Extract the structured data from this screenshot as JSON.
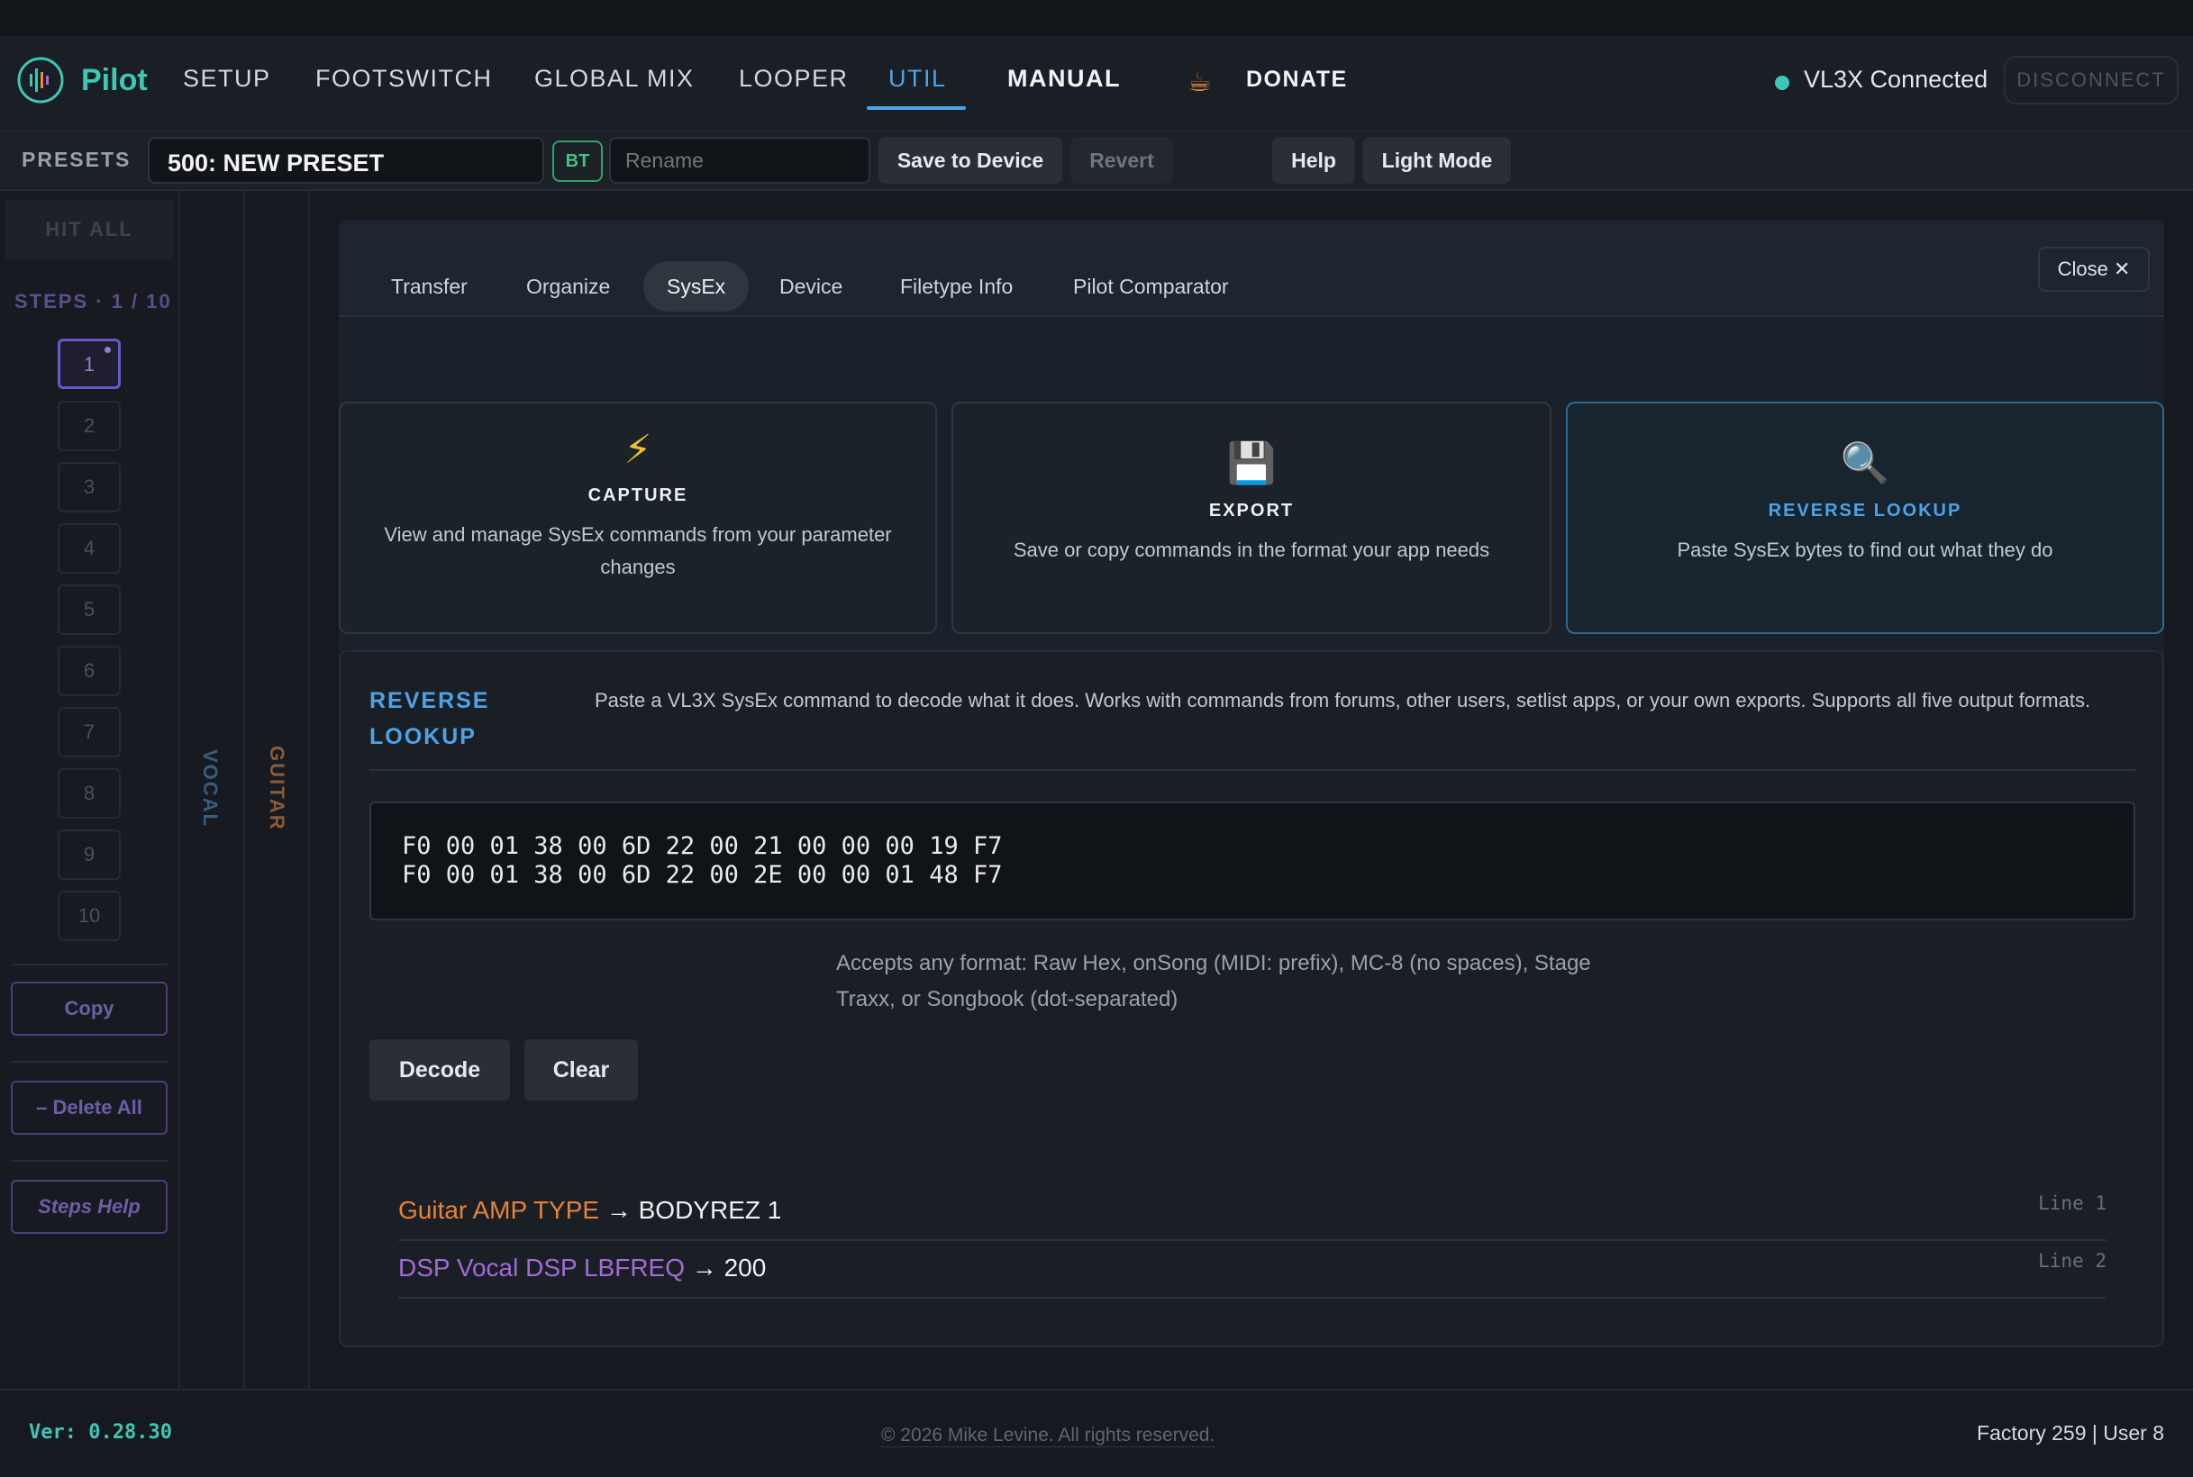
{
  "nav": {
    "brand": "Pilot",
    "items": [
      "SETUP",
      "FOOTSWITCH",
      "GLOBAL MIX",
      "LOOPER",
      "UTIL",
      "MANUAL",
      "DONATE"
    ],
    "active": "UTIL",
    "status": "VL3X Connected",
    "disconnect": "DISCONNECT",
    "accent_color": "#4da3e8",
    "brand_color": "#3dc7b5"
  },
  "presets": {
    "label": "PRESETS",
    "current": "500: NEW PRESET",
    "bt_badge": "BT",
    "rename_placeholder": "Rename",
    "save": "Save to Device",
    "revert": "Revert",
    "help": "Help",
    "light_mode": "Light Mode"
  },
  "sidebar": {
    "hit_all": "HIT ALL",
    "steps_label": "STEPS · 1 / 10",
    "steps": [
      "1",
      "2",
      "3",
      "4",
      "5",
      "6",
      "7",
      "8",
      "9",
      "10"
    ],
    "copy": "Copy",
    "delete_all": "– Delete All",
    "steps_help": "Steps Help",
    "vocal": "VOCAL",
    "guitar": "GUITAR"
  },
  "util": {
    "tabs": [
      "Transfer",
      "Organize",
      "SysEx",
      "Device",
      "Filetype Info",
      "Pilot Comparator"
    ],
    "active_tab": "SysEx",
    "close": "Close ✕",
    "cards": [
      {
        "icon": "lightning-icon",
        "glyph": "⚡",
        "title": "CAPTURE",
        "desc": "View and manage SysEx commands from your parameter changes"
      },
      {
        "icon": "floppy-disk-icon",
        "glyph": "💾",
        "title": "EXPORT",
        "desc": "Save or copy commands in the format your app needs"
      },
      {
        "icon": "magnifier-icon",
        "glyph": "🔍",
        "title": "REVERSE LOOKUP",
        "desc": "Paste SysEx bytes to find out what they do"
      }
    ],
    "lookup": {
      "title": "REVERSE LOOKUP",
      "description": "Paste a VL3X SysEx command to decode what it does. Works with commands from forums, other users, setlist apps, or your own exports. Supports all five output formats.",
      "input_value": "F0 00 01 38 00 6D 22 00 21 00 00 00 19 F7\nF0 00 01 38 00 6D 22 00 2E 00 00 01 48 F7",
      "accepts": "Accepts any format: Raw Hex, onSong (MIDI: prefix), MC-8 (no spaces), Stage Traxx, or Songbook (dot-separated)",
      "decode": "Decode",
      "clear": "Clear",
      "results": [
        {
          "param": "Guitar AMP TYPE",
          "arrow": "→",
          "value": "BODYREZ 1",
          "line": "Line 1",
          "color": "#e6823a"
        },
        {
          "param": "DSP Vocal DSP LBFREQ",
          "arrow": "→",
          "value": "200",
          "line": "Line 2",
          "color": "#a36ad6"
        }
      ]
    }
  },
  "footer": {
    "version": "Ver: 0.28.30",
    "copyright": "© 2026 Mike Levine. All rights reserved.",
    "counts": "Factory 259 | User 8"
  }
}
